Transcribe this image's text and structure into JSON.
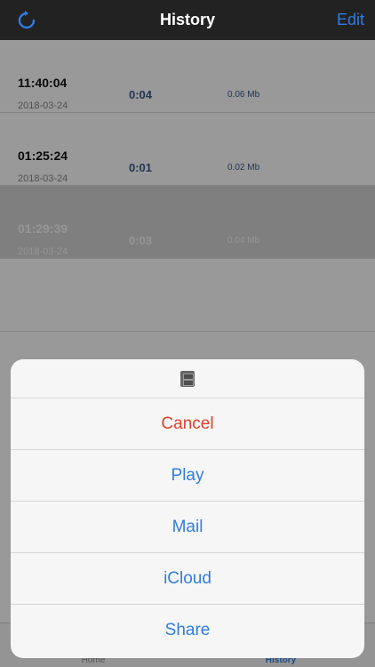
{
  "nav": {
    "title": "History",
    "edit_label": "Edit",
    "refresh_icon": "refresh-icon"
  },
  "recordings": [
    {
      "time": "11:40:04",
      "date": "2018-03-24",
      "duration": "0:04",
      "size": "0.06 Mb",
      "selected": false
    },
    {
      "time": "01:25:24",
      "date": "2018-03-24",
      "duration": "0:01",
      "size": "0.02 Mb",
      "selected": false
    },
    {
      "time": "01:29:39",
      "date": "2018-03-24",
      "duration": "0:03",
      "size": "0.04 Mb",
      "selected": true
    }
  ],
  "tabbar": {
    "home_label": "Home",
    "history_label": "History"
  },
  "action_sheet": {
    "header_icon": "file-cabinet-icon",
    "cancel_label": "Cancel",
    "play_label": "Play",
    "mail_label": "Mail",
    "icloud_label": "iCloud",
    "share_label": "Share"
  },
  "colors": {
    "accent": "#2f7de1",
    "destructive": "#e0402c",
    "navbar": "#222222"
  }
}
